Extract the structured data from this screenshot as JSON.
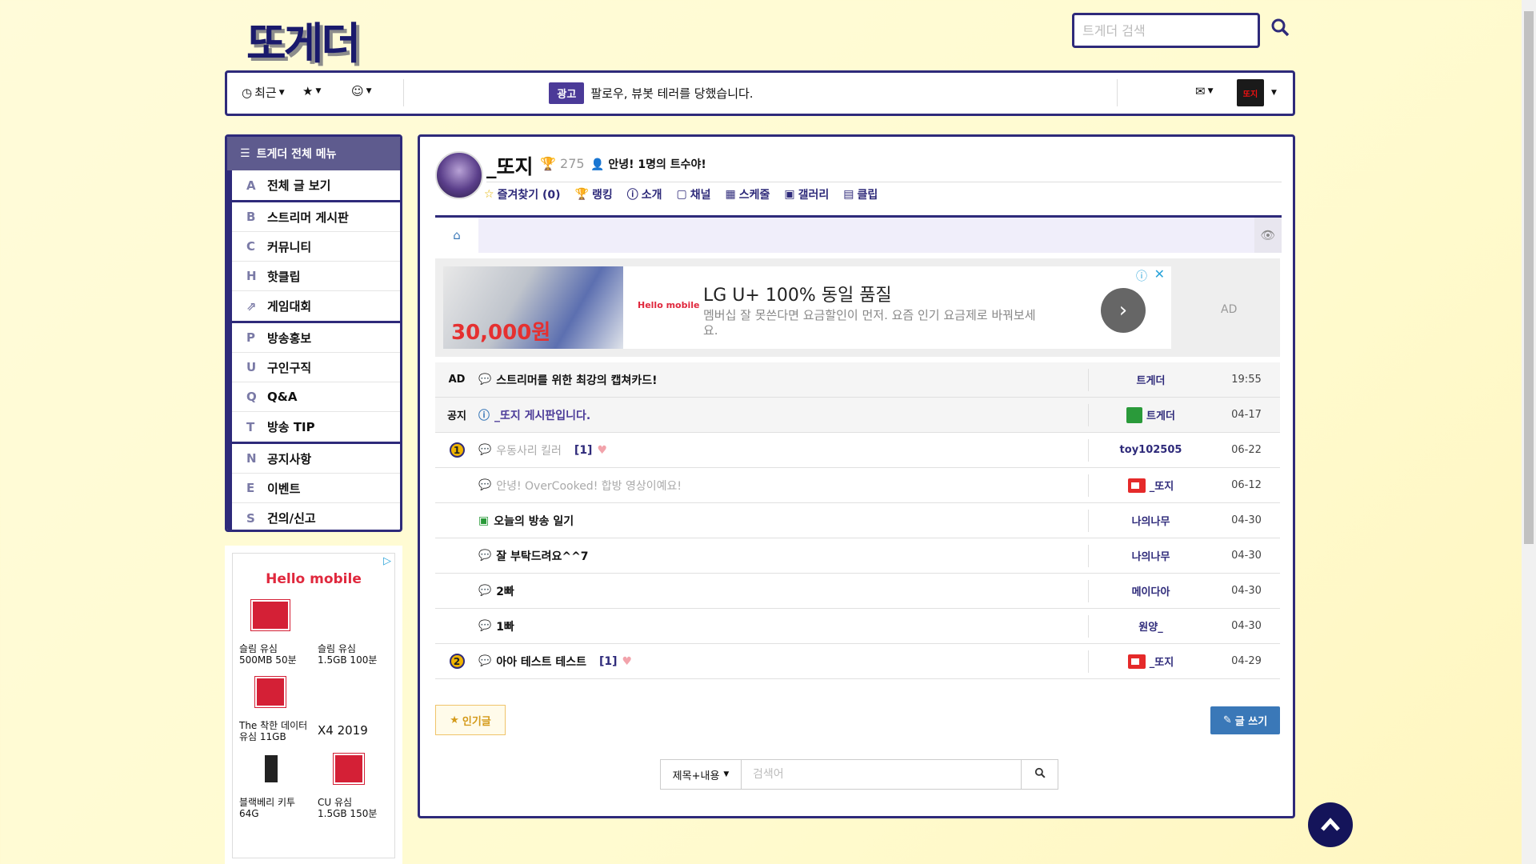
{
  "header": {
    "logo": "또게더",
    "search_placeholder": "트게더 검색"
  },
  "nav": {
    "recent": "최근",
    "notice_badge": "광고",
    "notice_text": "팔로우, 뷰봇 테러를 당했습니다.",
    "avatar_text": "또지"
  },
  "sidebar": {
    "title": "트게더 전체 메뉴",
    "groups": [
      [
        {
          "letter": "A",
          "label": "전체 글 보기"
        }
      ],
      [
        {
          "letter": "B",
          "label": "스트리머 게시판"
        },
        {
          "letter": "C",
          "label": "커뮤니티"
        },
        {
          "letter": "H",
          "label": "핫클립"
        },
        {
          "letter": "",
          "label": "게임대회"
        }
      ],
      [
        {
          "letter": "P",
          "label": "방송홍보"
        },
        {
          "letter": "U",
          "label": "구인구직"
        },
        {
          "letter": "Q",
          "label": "Q&A"
        },
        {
          "letter": "T",
          "label": "방송 TIP"
        }
      ],
      [
        {
          "letter": "N",
          "label": "공지사항"
        },
        {
          "letter": "E",
          "label": "이벤트"
        },
        {
          "letter": "S",
          "label": "건의/신고"
        }
      ]
    ]
  },
  "side_ad": {
    "brand": "Hello mobile",
    "products": [
      {
        "name": "슬림 유심\n500MB 50분"
      },
      {
        "name": "슬림 유심\n1.5GB 100분"
      },
      {
        "name": "The 착한 데이터\n유심 11GB"
      },
      {
        "name": "X4 2019"
      },
      {
        "name": "블랙베리 키투\n64G"
      },
      {
        "name": "CU 유심\n1.5GB 150분"
      }
    ]
  },
  "channel": {
    "name": "_또지",
    "trophy": "275",
    "greeting": "안녕! 1명의 트수야!",
    "links": [
      "즐겨찾기 (0)",
      "랭킹",
      "소개",
      "채널",
      "스케줄",
      "갤러리",
      "클립"
    ]
  },
  "ad_banner": {
    "price": "30,000원",
    "brand": "Hello mobile",
    "title": "LG U+ 100% 동일 품질",
    "desc": "멤버십 잘 못쓴다면 요금할인이 먼저. 요즘 인기 요금제로 바꿔보세요.",
    "label": "AD"
  },
  "board": {
    "rows": [
      {
        "num": "AD",
        "title": "스트리머를 위한 최강의 캡쳐카드!",
        "author": "트게더",
        "date": "19:55",
        "style": "gray"
      },
      {
        "num": "공지",
        "title": "_또지 게시판입니다.",
        "author": "트게더",
        "date": "04-17",
        "style": "gray"
      },
      {
        "num": "1",
        "title": "우동사리 킬러",
        "comments": "[1]",
        "author": "toy102505",
        "date": "06-22",
        "style": "muted"
      },
      {
        "num": "",
        "title": "안녕! OverCooked! 합방 영상이예요!",
        "author": "_또지",
        "date": "06-12",
        "style": "muted"
      },
      {
        "num": "",
        "title": "오늘의 방송 일기",
        "author": "나의나무",
        "date": "04-30",
        "style": ""
      },
      {
        "num": "",
        "title": "잘 부탁드려요^^7",
        "author": "나의나무",
        "date": "04-30",
        "style": ""
      },
      {
        "num": "",
        "title": "2빠",
        "author": "메이다아",
        "date": "04-30",
        "style": ""
      },
      {
        "num": "",
        "title": "1빠",
        "author": "원양_",
        "date": "04-30",
        "style": ""
      },
      {
        "num": "2",
        "title": "아아 테스트 테스트",
        "comments": "[1]",
        "author": "_또지",
        "date": "04-29",
        "style": ""
      }
    ],
    "popular_label": "인기글",
    "write_label": "글 쓰기",
    "search_select": "제목+내용",
    "search_placeholder": "검색어"
  }
}
